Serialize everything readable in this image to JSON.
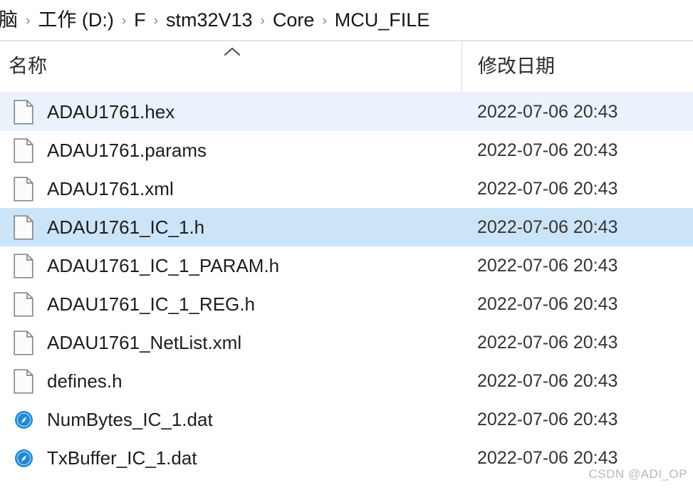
{
  "breadcrumb": {
    "separator": "›",
    "items": [
      {
        "label": "脑",
        "name": "breadcrumb-item-this-pc"
      },
      {
        "label": "工作 (D:)",
        "name": "breadcrumb-item-work-d"
      },
      {
        "label": "F",
        "name": "breadcrumb-item-f"
      },
      {
        "label": "stm32V13",
        "name": "breadcrumb-item-stm32v13"
      },
      {
        "label": "Core",
        "name": "breadcrumb-item-core"
      },
      {
        "label": "MCU_FILE",
        "name": "breadcrumb-item-mcu-file"
      }
    ]
  },
  "columns": {
    "name_header": "名称",
    "date_header": "修改日期",
    "sort_icon": "chevron-up-icon",
    "sort_direction": "ascending"
  },
  "colors": {
    "hover_row": "#EAF3FB",
    "selected_row": "#CCE4F7",
    "dat_icon_blue": "#1E88D0",
    "doc_icon_outline": "#888888"
  },
  "files": [
    {
      "name": "ADAU1761.hex",
      "date": "2022-07-06 20:43",
      "icon": "blank-document-icon",
      "state": "hovered"
    },
    {
      "name": "ADAU1761.params",
      "date": "2022-07-06 20:43",
      "icon": "blank-document-icon",
      "state": "normal"
    },
    {
      "name": "ADAU1761.xml",
      "date": "2022-07-06 20:43",
      "icon": "blank-document-icon",
      "state": "normal"
    },
    {
      "name": "ADAU1761_IC_1.h",
      "date": "2022-07-06 20:43",
      "icon": "blank-document-icon",
      "state": "selected"
    },
    {
      "name": "ADAU1761_IC_1_PARAM.h",
      "date": "2022-07-06 20:43",
      "icon": "blank-document-icon",
      "state": "normal"
    },
    {
      "name": "ADAU1761_IC_1_REG.h",
      "date": "2022-07-06 20:43",
      "icon": "blank-document-icon",
      "state": "normal"
    },
    {
      "name": "ADAU1761_NetList.xml",
      "date": "2022-07-06 20:43",
      "icon": "blank-document-icon",
      "state": "normal"
    },
    {
      "name": "defines.h",
      "date": "2022-07-06 20:43",
      "icon": "blank-document-icon",
      "state": "normal"
    },
    {
      "name": "NumBytes_IC_1.dat",
      "date": "2022-07-06 20:43",
      "icon": "blue-disc-icon",
      "state": "normal"
    },
    {
      "name": "TxBuffer_IC_1.dat",
      "date": "2022-07-06 20:43",
      "icon": "blue-disc-icon",
      "state": "normal"
    }
  ],
  "watermark": {
    "text": "CSDN @ADI_OP"
  }
}
